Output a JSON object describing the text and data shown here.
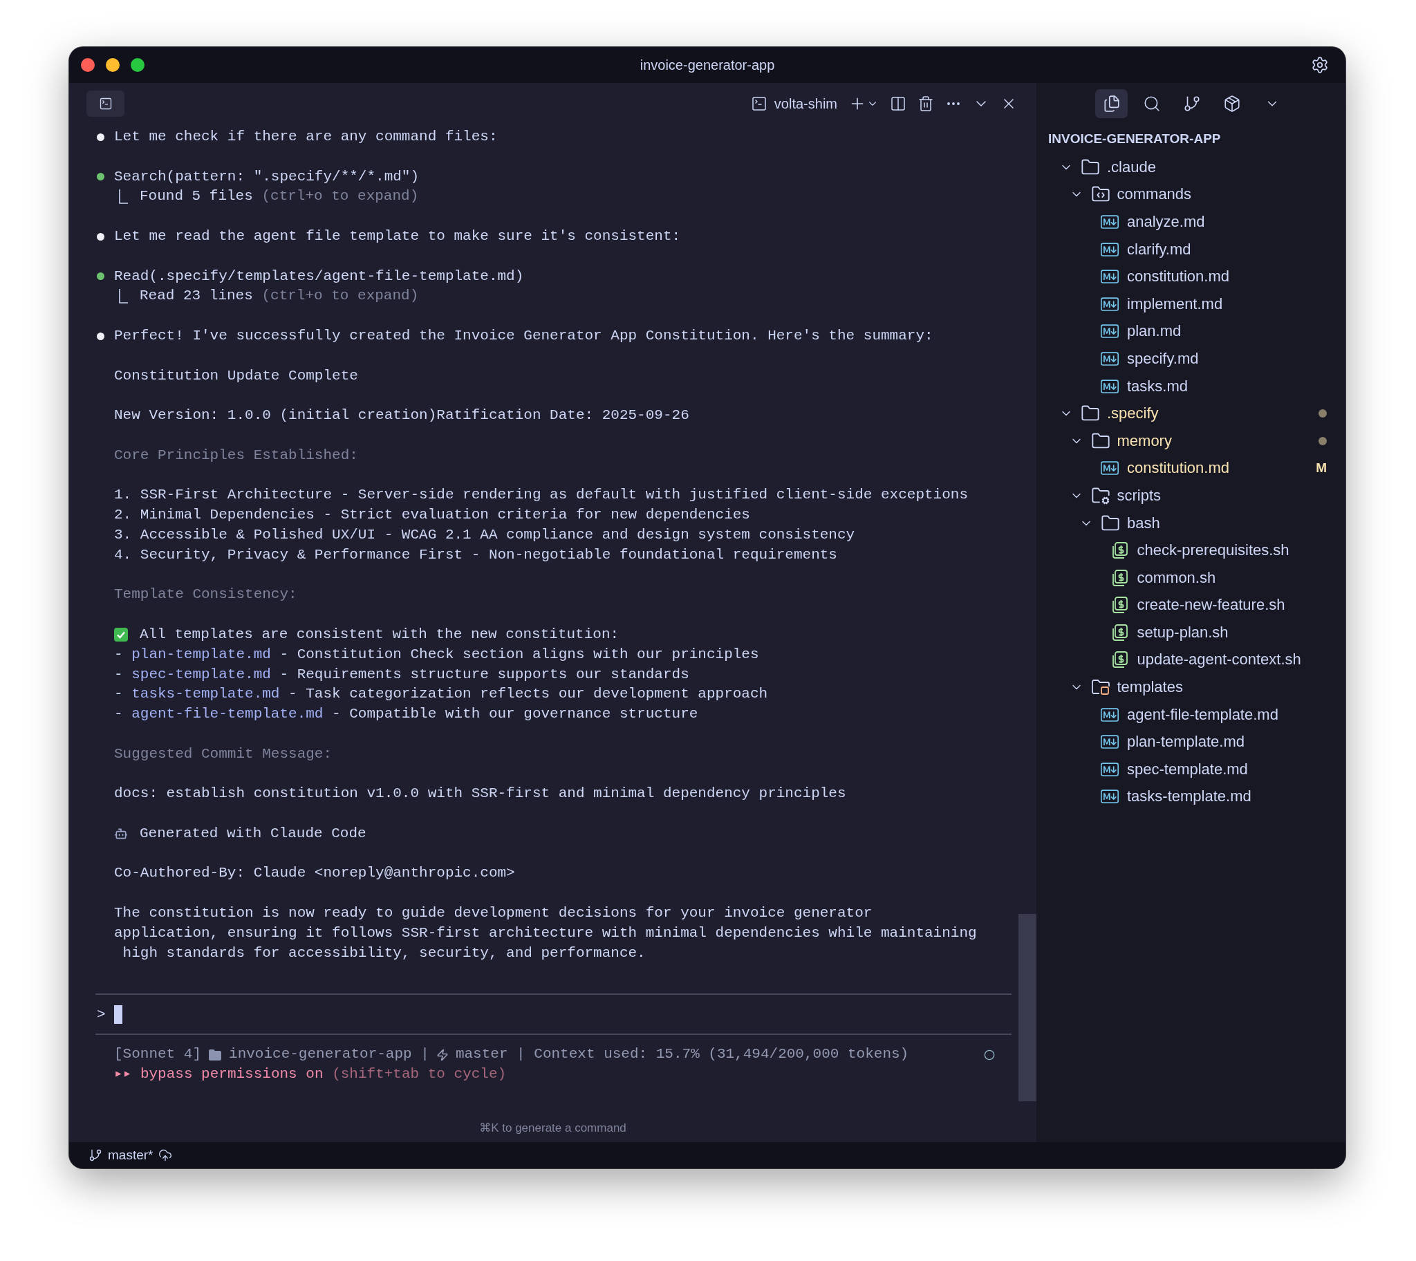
{
  "window": {
    "title": "invoice-generator-app"
  },
  "terminal": {
    "tab": {
      "label": "volta-shim"
    },
    "blocks": [
      [
        {
          "kind": "assistant",
          "text": "Let me check if there are any command files:"
        }
      ],
      [
        {
          "kind": "tool",
          "text": "Search(pattern: \".specify/**/*.md\")"
        },
        {
          "kind": "result",
          "text": "Found 5 files",
          "hint": "(ctrl+o to expand)"
        }
      ],
      [
        {
          "kind": "assistant",
          "text": "Let me read the agent file template to make sure it's consistent:"
        }
      ],
      [
        {
          "kind": "tool",
          "text": "Read(.specify/templates/agent-file-template.md)"
        },
        {
          "kind": "result",
          "text": "Read 23 lines",
          "hint": "(ctrl+o to expand)"
        }
      ],
      [
        {
          "kind": "assistant",
          "text": "Perfect! I've successfully created the Invoice Generator App Constitution. Here's the summary:"
        }
      ],
      [
        {
          "kind": "text",
          "text": "Constitution Update Complete"
        }
      ],
      [
        {
          "kind": "text",
          "text": "New Version: 1.0.0 (initial creation)Ratification Date: 2025-09-26"
        }
      ],
      [
        {
          "kind": "dim",
          "text": "Core Principles Established:"
        }
      ],
      [
        {
          "kind": "text",
          "text": "1. SSR-First Architecture - Server-side rendering as default with justified client-side exceptions"
        },
        {
          "kind": "text",
          "text": "2. Minimal Dependencies - Strict evaluation criteria for new dependencies"
        },
        {
          "kind": "text",
          "text": "3. Accessible & Polished UX/UI - WCAG 2.1 AA compliance and design system consistency"
        },
        {
          "kind": "text",
          "text": "4. Security, Privacy & Performance First - Non-negotiable foundational requirements"
        }
      ],
      [
        {
          "kind": "dim",
          "text": "Template Consistency:"
        }
      ],
      [
        {
          "kind": "check",
          "text": "All templates are consistent with the new constitution:"
        },
        {
          "kind": "file_item",
          "dash": "-",
          "link": "plan-template.md",
          "text": "- Constitution Check section aligns with our principles"
        },
        {
          "kind": "file_item",
          "dash": "-",
          "link": "spec-template.md",
          "text": "- Requirements structure supports our standards"
        },
        {
          "kind": "file_item",
          "dash": "-",
          "link": "tasks-template.md",
          "text": "- Task categorization reflects our development approach"
        },
        {
          "kind": "file_item",
          "dash": "-",
          "link": "agent-file-template.md",
          "text": "- Compatible with our governance structure"
        }
      ],
      [
        {
          "kind": "dim",
          "text": "Suggested Commit Message:"
        }
      ],
      [
        {
          "kind": "text",
          "text": "docs: establish constitution v1.0.0 with SSR-first and minimal dependency principles"
        }
      ],
      [
        {
          "kind": "robot",
          "text": "Generated with Claude Code"
        }
      ],
      [
        {
          "kind": "text",
          "text": "Co-Authored-By: Claude <noreply@anthropic.com>"
        }
      ],
      [
        {
          "kind": "text",
          "text": "The constitution is now ready to guide development decisions for your invoice generator"
        },
        {
          "kind": "text",
          "text": "application, ensuring it follows SSR-first architecture with minimal dependencies while maintaining"
        },
        {
          "kind": "text",
          "text": " high standards for accessibility, security, and performance."
        }
      ]
    ],
    "prompt": {
      "symbol": ">"
    },
    "status_line": {
      "model": "[Sonnet 4]",
      "project": "invoice-generator-app |",
      "branch": "master | Context used: 15.7% (31,494/200,000 tokens)"
    },
    "mode_line": {
      "label": "▸▸ bypass permissions on",
      "hint": "(shift+tab to cycle)"
    },
    "hint": "⌘K to generate a command"
  },
  "sidebar": {
    "tools": [
      {
        "kind": "files",
        "selected": true
      },
      {
        "kind": "search",
        "selected": false
      },
      {
        "kind": "source-control",
        "selected": false
      },
      {
        "kind": "extensions",
        "selected": false
      },
      {
        "kind": "more",
        "selected": false
      }
    ],
    "title": "INVOICE-GENERATOR-APP",
    "tree": [
      {
        "label": ".claude",
        "kind": "folder",
        "expanded": true,
        "modified": false,
        "children": [
          {
            "label": "commands",
            "kind": "command-folder",
            "expanded": true,
            "modified": false,
            "children": [
              {
                "label": "analyze.md",
                "kind": "markdown",
                "modified": false
              },
              {
                "label": "clarify.md",
                "kind": "markdown",
                "modified": false
              },
              {
                "label": "constitution.md",
                "kind": "markdown",
                "modified": false
              },
              {
                "label": "implement.md",
                "kind": "markdown",
                "modified": false
              },
              {
                "label": "plan.md",
                "kind": "markdown",
                "modified": false
              },
              {
                "label": "specify.md",
                "kind": "markdown",
                "modified": false
              },
              {
                "label": "tasks.md",
                "kind": "markdown",
                "modified": false
              }
            ]
          }
        ]
      },
      {
        "label": ".specify",
        "kind": "folder",
        "expanded": true,
        "modified": true,
        "children": [
          {
            "label": "memory",
            "kind": "folder",
            "expanded": true,
            "modified": true,
            "children": [
              {
                "label": "constitution.md",
                "kind": "markdown",
                "modified": true,
                "badge": "M"
              }
            ]
          },
          {
            "label": "scripts",
            "kind": "script-folder",
            "expanded": true,
            "modified": false,
            "children": [
              {
                "label": "bash",
                "kind": "folder",
                "expanded": true,
                "modified": false,
                "children": [
                  {
                    "label": "check-prerequisites.sh",
                    "kind": "shell",
                    "modified": false
                  },
                  {
                    "label": "common.sh",
                    "kind": "shell",
                    "modified": false
                  },
                  {
                    "label": "create-new-feature.sh",
                    "kind": "shell",
                    "modified": false
                  },
                  {
                    "label": "setup-plan.sh",
                    "kind": "shell",
                    "modified": false
                  },
                  {
                    "label": "update-agent-context.sh",
                    "kind": "shell",
                    "modified": false
                  }
                ]
              }
            ]
          },
          {
            "label": "templates",
            "kind": "template-folder",
            "expanded": true,
            "modified": false,
            "children": [
              {
                "label": "agent-file-template.md",
                "kind": "markdown",
                "modified": false
              },
              {
                "label": "plan-template.md",
                "kind": "markdown",
                "modified": false
              },
              {
                "label": "spec-template.md",
                "kind": "markdown",
                "modified": false
              },
              {
                "label": "tasks-template.md",
                "kind": "markdown",
                "modified": false
              }
            ]
          }
        ]
      }
    ]
  },
  "status_bar": {
    "branch": "master*"
  }
}
